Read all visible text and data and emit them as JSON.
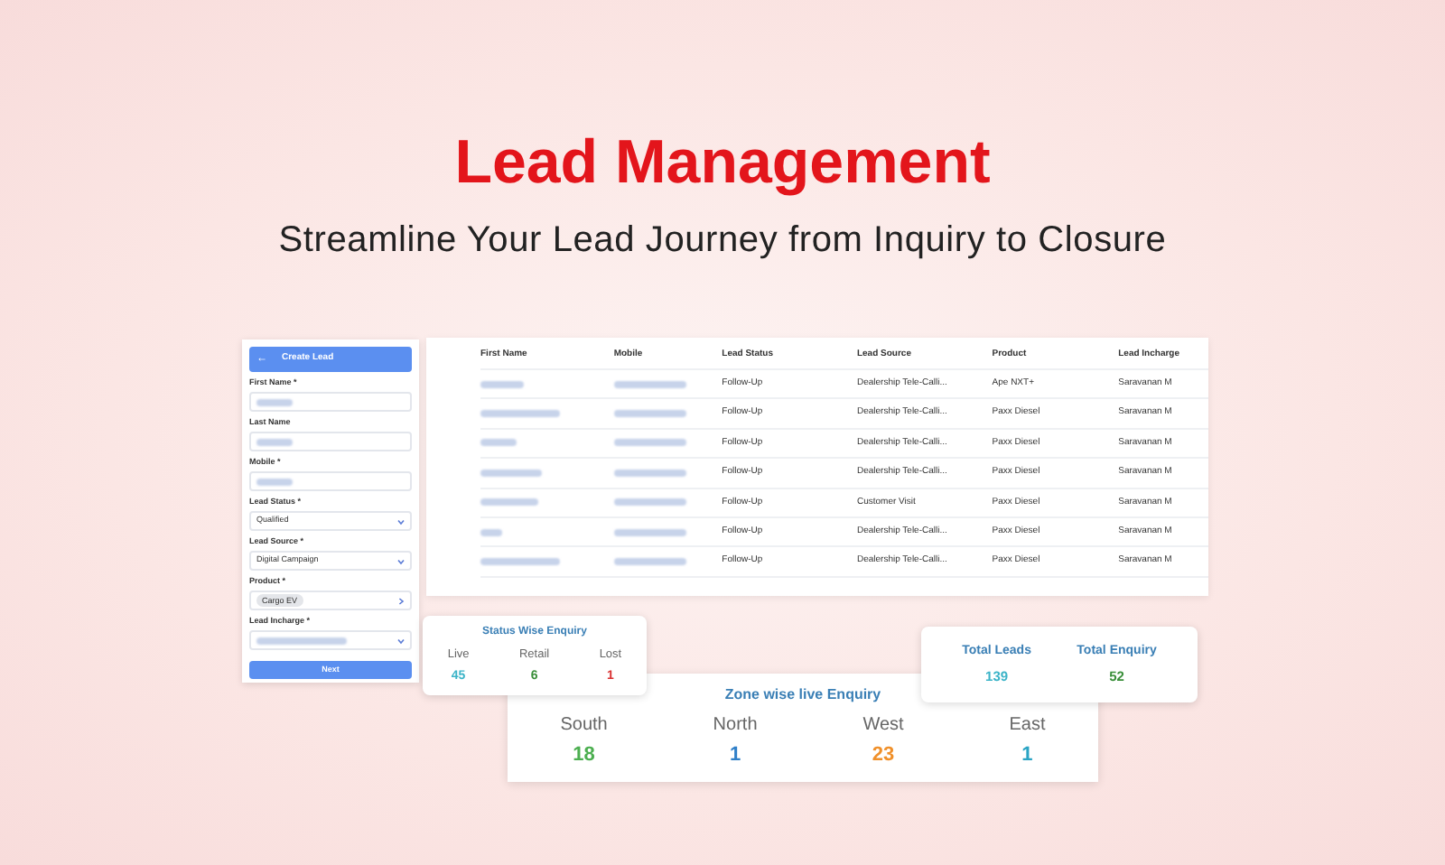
{
  "hero": {
    "title": "Lead Management",
    "subtitle": "Streamline Your Lead Journey from Inquiry to Closure"
  },
  "form": {
    "back": "←",
    "title": "Create Lead",
    "button": "Next",
    "fields": [
      {
        "label": "First Name *",
        "kind": "blurred"
      },
      {
        "label": "Last Name",
        "kind": "blurred"
      },
      {
        "label": "Mobile *",
        "kind": "blurred"
      },
      {
        "label": "Lead Status *",
        "kind": "select",
        "value": "Qualified"
      },
      {
        "label": "Lead Source *",
        "kind": "select",
        "value": "Digital Campaign"
      },
      {
        "label": "Product *",
        "kind": "chip",
        "value": "Cargo EV"
      },
      {
        "label": "Lead Incharge *",
        "kind": "blurred_select"
      }
    ]
  },
  "table": {
    "columns": [
      "First Name",
      "Mobile",
      "Lead Status",
      "Lead Source",
      "Product",
      "Lead Incharge"
    ],
    "rows": [
      {
        "lead_status": "Follow-Up",
        "lead_source": "Dealership Tele-Calli...",
        "product": "Ape NXT+",
        "lead_incharge": "Saravanan M"
      },
      {
        "lead_status": "Follow-Up",
        "lead_source": "Dealership Tele-Calli...",
        "product": "Paxx Diesel",
        "lead_incharge": "Saravanan M"
      },
      {
        "lead_status": "Follow-Up",
        "lead_source": "Dealership Tele-Calli...",
        "product": "Paxx Diesel",
        "lead_incharge": "Saravanan M"
      },
      {
        "lead_status": "Follow-Up",
        "lead_source": "Dealership Tele-Calli...",
        "product": "Paxx Diesel",
        "lead_incharge": "Saravanan M"
      },
      {
        "lead_status": "Follow-Up",
        "lead_source": "Customer Visit",
        "product": "Paxx Diesel",
        "lead_incharge": "Saravanan M"
      },
      {
        "lead_status": "Follow-Up",
        "lead_source": "Dealership Tele-Calli...",
        "product": "Paxx Diesel",
        "lead_incharge": "Saravanan M"
      },
      {
        "lead_status": "Follow-Up",
        "lead_source": "Dealership Tele-Calli...",
        "product": "Paxx Diesel",
        "lead_incharge": "Saravanan M"
      }
    ]
  },
  "status_card": {
    "title": "Status Wise Enquiry",
    "stats": [
      {
        "label": "Live",
        "value": "45",
        "color": "#3cb4c8"
      },
      {
        "label": "Retail",
        "value": "6",
        "color": "#3a8f3a"
      },
      {
        "label": "Lost",
        "value": "1",
        "color": "#d93030"
      }
    ]
  },
  "zone_card": {
    "title": "Zone wise live Enquiry",
    "stats": [
      {
        "label": "South",
        "value": "18",
        "color": "#4caf50"
      },
      {
        "label": "North",
        "value": "1",
        "color": "#2f7fc8"
      },
      {
        "label": "West",
        "value": "23",
        "color": "#f0902a"
      },
      {
        "label": "East",
        "value": "1",
        "color": "#2aa4c4"
      }
    ]
  },
  "totals_card": {
    "stats": [
      {
        "label": "Total Leads",
        "value": "139",
        "color": "#3cb4c8"
      },
      {
        "label": "Total Enquiry",
        "value": "52",
        "color": "#3a8f3a"
      }
    ]
  }
}
